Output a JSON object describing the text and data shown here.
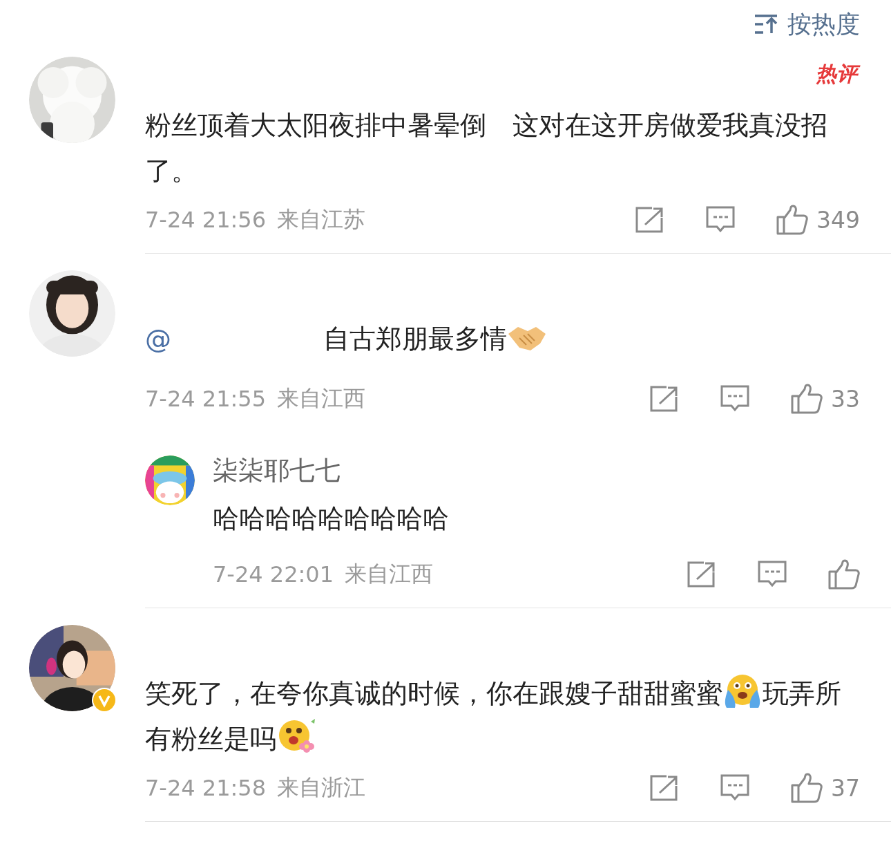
{
  "sort": {
    "label": "按热度"
  },
  "comments": [
    {
      "hot_label": "热评",
      "body": [
        {
          "kind": "text",
          "text": "粉丝顶着大太阳夜排中暑晕倒　这对在这开房做爱我真没招了。"
        }
      ],
      "time": "7-24 21:56",
      "location": "来自江苏",
      "likes": "349"
    },
    {
      "body": [
        {
          "kind": "mention",
          "text": "@"
        },
        {
          "kind": "text",
          "text": "自古郑朋最多情"
        },
        {
          "kind": "emoji"
        }
      ],
      "time": "7-24 21:55",
      "location": "来自江西",
      "likes": "33",
      "children": [
        {
          "name": "柒柒耶七七",
          "body": [
            {
              "kind": "text",
              "text": "哈哈哈哈哈哈哈哈哈"
            }
          ],
          "time": "7-24 22:01",
          "location": "来自江西"
        }
      ]
    },
    {
      "verified": true,
      "body": [
        {
          "kind": "text",
          "text": "笑死了，在夸你真诚的时候，你在跟嫂子甜甜蜜蜜"
        },
        {
          "kind": "emoji"
        },
        {
          "kind": "text",
          "text": "玩弄所有粉丝是吗"
        },
        {
          "kind": "emoji"
        }
      ],
      "time": "7-24 21:58",
      "location": "来自浙江",
      "likes": "37"
    }
  ]
}
